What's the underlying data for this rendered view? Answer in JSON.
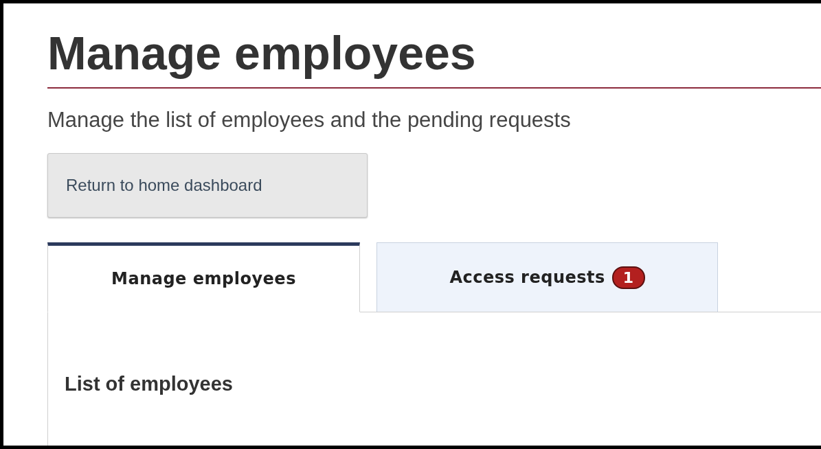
{
  "title": "Manage employees",
  "subtitle": "Manage the list of employees and the pending requests",
  "back_button": "Return to home dashboard",
  "tabs": [
    {
      "label": "Manage employees",
      "selected": true
    },
    {
      "label": "Access requests",
      "selected": false,
      "badge": "1"
    }
  ],
  "section_heading": "List of employees"
}
